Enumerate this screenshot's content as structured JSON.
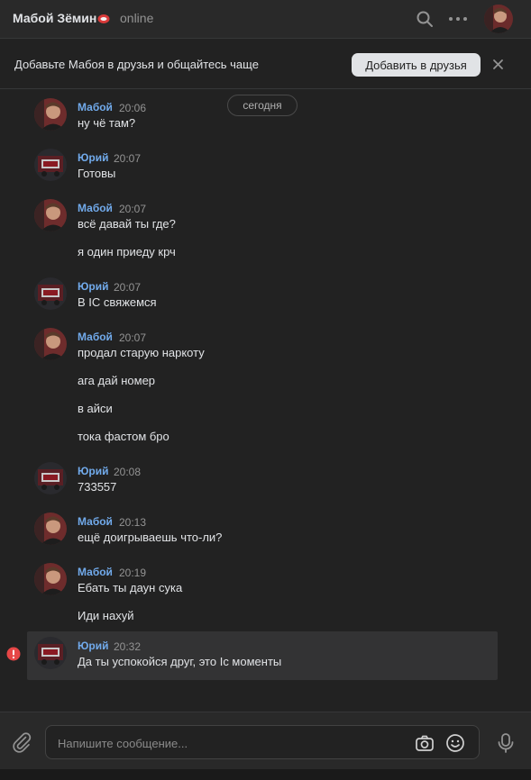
{
  "header": {
    "peer_name": "Мабой Зёмин",
    "status": "online"
  },
  "banner": {
    "text": "Добавьте Мабоя в друзья и общайтесь чаще",
    "button_label": "Добавить в друзья"
  },
  "date_divider": "сегодня",
  "messages": [
    {
      "author": "Мабой",
      "time": "20:06",
      "lines": [
        "ну чё там?"
      ]
    },
    {
      "author": "Юрий",
      "time": "20:07",
      "lines": [
        "Готовы"
      ]
    },
    {
      "author": "Мабой",
      "time": "20:07",
      "lines": [
        "всё давай ты где?",
        "я один приеду крч"
      ]
    },
    {
      "author": "Юрий",
      "time": "20:07",
      "lines": [
        "В IC свяжемся"
      ]
    },
    {
      "author": "Мабой",
      "time": "20:07",
      "lines": [
        "продал старую наркоту",
        "ага дай номер",
        "в айси",
        "тока фастом бро"
      ]
    },
    {
      "author": "Юрий",
      "time": "20:08",
      "lines": [
        "733557"
      ]
    },
    {
      "author": "Мабой",
      "time": "20:13",
      "lines": [
        "ещё доигрываешь что-ли?"
      ]
    },
    {
      "author": "Мабой",
      "time": "20:19",
      "lines": [
        "Ебать ты даун сука",
        "Иди нахуй"
      ]
    },
    {
      "author": "Юрий",
      "time": "20:32",
      "lines": [
        "Да ты успокойся друг, это Ic моменты"
      ],
      "failed": true
    }
  ],
  "composer": {
    "placeholder": "Напишите сообщение..."
  },
  "colors": {
    "background": "#222222",
    "author_link": "#71aaeb",
    "error": "#e64646"
  }
}
